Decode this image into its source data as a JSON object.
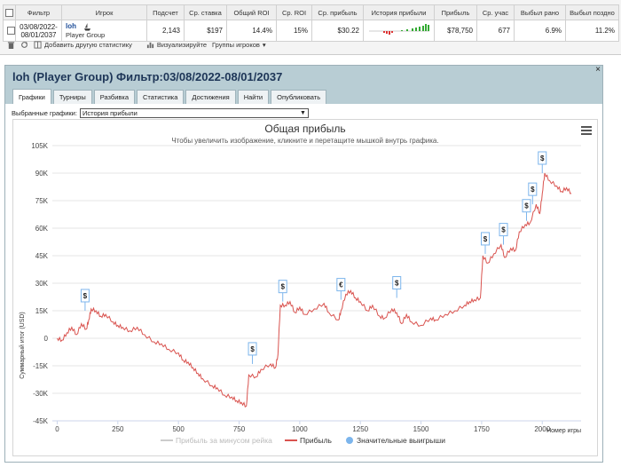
{
  "stats_table": {
    "headers": [
      "Фильтр",
      "Игрок",
      "Подсчет",
      "Ср. ставка",
      "Общий ROI",
      "Ср. ROI",
      "Ср. прибыль",
      "История прибыли",
      "Прибыль",
      "Ср. учас",
      "Выбыл рано",
      "Выбыл поздно"
    ],
    "row": {
      "filter_line1": "03/08/2022-",
      "filter_line2": "08/01/2037",
      "player_name": "loh",
      "player_group": "Player Group",
      "count": "2,143",
      "avg_stake": "$197",
      "total_roi": "14.4%",
      "avg_roi": "15%",
      "avg_profit": "$30.22",
      "profit": "$78,750",
      "avg_entrants": "677",
      "early_out": "6.9%",
      "late_out": "11.2%"
    }
  },
  "toolbar": {
    "add_stat": "Добавить другую статистику",
    "visualize": "Визуализируйте",
    "player_groups": "Группы игроков"
  },
  "panel": {
    "title": "loh (Player Group) Фильтр:03/08/2022-08/01/2037",
    "close": "×",
    "tabs": [
      "Графики",
      "Турниры",
      "Разбивка",
      "Статистика",
      "Достижения",
      "Найти",
      "Опубликовать"
    ],
    "select_label": "Выбранные графики:",
    "select_value": "История прибыли"
  },
  "chart_data": {
    "type": "line",
    "title": "Общая прибыль",
    "subtitle": "Чтобы увеличить изображение, кликните и перетащите мышкой внутрь графика.",
    "ylabel": "Суммарный итог (USD)",
    "xlabel": "Номер игры",
    "ylim": [
      -45000,
      105000
    ],
    "xlim": [
      -20,
      2160
    ],
    "yticks": [
      -45000,
      -30000,
      -15000,
      0,
      15000,
      30000,
      45000,
      60000,
      75000,
      90000,
      105000
    ],
    "ytick_labels": [
      "-45K",
      "-30K",
      "-15K",
      "0",
      "15K",
      "30K",
      "45K",
      "60K",
      "75K",
      "90K",
      "105K"
    ],
    "xticks": [
      0,
      250,
      500,
      750,
      1000,
      1250,
      1500,
      1750,
      2000
    ],
    "xtick_labels": [
      "0",
      "250",
      "500",
      "750",
      "1000",
      "1250",
      "1500",
      "1750",
      "2000"
    ],
    "colors": {
      "profit": "#d9534f",
      "adjusted": "#cccccc",
      "markers": "#7cb5ec"
    },
    "series": [
      {
        "name": "Прибыль",
        "points": [
          [
            0,
            0
          ],
          [
            20,
            -1000
          ],
          [
            40,
            3000
          ],
          [
            60,
            6000
          ],
          [
            80,
            2000
          ],
          [
            100,
            8000
          ],
          [
            120,
            5000
          ],
          [
            130,
            10000
          ],
          [
            140,
            16000
          ],
          [
            160,
            15000
          ],
          [
            180,
            12000
          ],
          [
            200,
            13000
          ],
          [
            230,
            9000
          ],
          [
            250,
            7000
          ],
          [
            270,
            6000
          ],
          [
            300,
            4000
          ],
          [
            330,
            6000
          ],
          [
            360,
            2000
          ],
          [
            400,
            -2000
          ],
          [
            430,
            -3000
          ],
          [
            460,
            -6000
          ],
          [
            500,
            -8000
          ],
          [
            520,
            -12000
          ],
          [
            540,
            -13000
          ],
          [
            560,
            -16000
          ],
          [
            580,
            -19000
          ],
          [
            600,
            -22000
          ],
          [
            640,
            -26000
          ],
          [
            660,
            -27000
          ],
          [
            690,
            -31000
          ],
          [
            720,
            -32000
          ],
          [
            740,
            -34000
          ],
          [
            760,
            -35000
          ],
          [
            780,
            -37000
          ],
          [
            790,
            -20000
          ],
          [
            820,
            -21000
          ],
          [
            840,
            -17000
          ],
          [
            880,
            -14000
          ],
          [
            900,
            -16000
          ],
          [
            910,
            -9000
          ],
          [
            920,
            18000
          ],
          [
            940,
            18000
          ],
          [
            960,
            20000
          ],
          [
            980,
            14000
          ],
          [
            1000,
            17000
          ],
          [
            1020,
            13000
          ],
          [
            1060,
            16000
          ],
          [
            1100,
            19000
          ],
          [
            1120,
            14000
          ],
          [
            1160,
            10000
          ],
          [
            1170,
            15000
          ],
          [
            1190,
            24000
          ],
          [
            1210,
            26000
          ],
          [
            1230,
            22000
          ],
          [
            1250,
            20000
          ],
          [
            1280,
            15000
          ],
          [
            1300,
            18000
          ],
          [
            1330,
            12000
          ],
          [
            1350,
            11000
          ],
          [
            1380,
            16000
          ],
          [
            1400,
            14000
          ],
          [
            1420,
            8000
          ],
          [
            1440,
            13000
          ],
          [
            1460,
            9000
          ],
          [
            1500,
            7000
          ],
          [
            1540,
            11000
          ],
          [
            1560,
            10000
          ],
          [
            1600,
            13000
          ],
          [
            1640,
            15000
          ],
          [
            1680,
            18000
          ],
          [
            1700,
            20000
          ],
          [
            1720,
            21000
          ],
          [
            1745,
            22000
          ],
          [
            1755,
            45000
          ],
          [
            1775,
            41000
          ],
          [
            1800,
            46000
          ],
          [
            1830,
            51000
          ],
          [
            1845,
            44000
          ],
          [
            1870,
            49000
          ],
          [
            1890,
            48000
          ],
          [
            1905,
            58000
          ],
          [
            1930,
            62000
          ],
          [
            1950,
            63000
          ],
          [
            1975,
            73000
          ],
          [
            1990,
            68000
          ],
          [
            2000,
            79000
          ],
          [
            2010,
            90000
          ],
          [
            2030,
            86000
          ],
          [
            2060,
            83000
          ],
          [
            2080,
            80000
          ],
          [
            2100,
            82000
          ],
          [
            2120,
            79000
          ]
        ]
      }
    ],
    "legend": [
      "Прибыль за минусом рейка",
      "Прибыль",
      "Значительные выигрыши"
    ],
    "big_wins": [
      {
        "x": 115,
        "y": 15000,
        "label": "$"
      },
      {
        "x": 805,
        "y": -14000,
        "label": "$"
      },
      {
        "x": 930,
        "y": 20000,
        "label": "$"
      },
      {
        "x": 1170,
        "y": 21000,
        "label": "€"
      },
      {
        "x": 1400,
        "y": 22000,
        "label": "$"
      },
      {
        "x": 1765,
        "y": 46000,
        "label": "$"
      },
      {
        "x": 1840,
        "y": 51000,
        "label": "$"
      },
      {
        "x": 1935,
        "y": 64000,
        "label": "$"
      },
      {
        "x": 1960,
        "y": 73000,
        "label": "$"
      },
      {
        "x": 2000,
        "y": 90000,
        "label": "$"
      }
    ]
  }
}
